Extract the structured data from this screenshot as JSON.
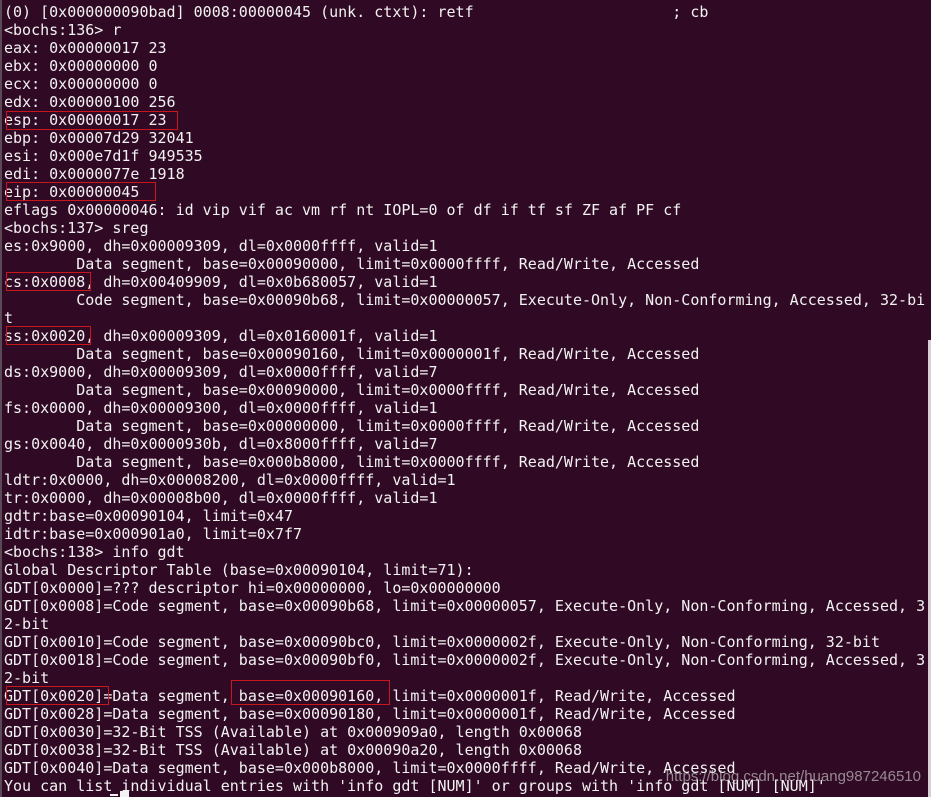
{
  "terminal": {
    "background": "#300a24",
    "highlight_color": "#c8161d",
    "lines": [
      "(0) [0x000000090bad] 0008:00000045 (unk. ctxt): retf                      ; cb",
      "<bochs:136> r",
      "eax: 0x00000017 23",
      "ebx: 0x00000000 0",
      "ecx: 0x00000000 0",
      "edx: 0x00000100 256",
      "esp: 0x00000017 23",
      "ebp: 0x00007d29 32041",
      "esi: 0x000e7d1f 949535",
      "edi: 0x0000077e 1918",
      "eip: 0x00000045",
      "eflags 0x00000046: id vip vif ac vm rf nt IOPL=0 of df if tf sf ZF af PF cf",
      "<bochs:137> sreg",
      "es:0x9000, dh=0x00009309, dl=0x0000ffff, valid=1",
      "        Data segment, base=0x00090000, limit=0x0000ffff, Read/Write, Accessed",
      "cs:0x0008, dh=0x00409909, dl=0x0b680057, valid=1",
      "        Code segment, base=0x00090b68, limit=0x00000057, Execute-Only, Non-Conforming, Accessed, 32-bi",
      "t",
      "ss:0x0020, dh=0x00009309, dl=0x0160001f, valid=1",
      "        Data segment, base=0x00090160, limit=0x0000001f, Read/Write, Accessed",
      "ds:0x9000, dh=0x00009309, dl=0x0000ffff, valid=7",
      "        Data segment, base=0x00090000, limit=0x0000ffff, Read/Write, Accessed",
      "fs:0x0000, dh=0x00009300, dl=0x0000ffff, valid=1",
      "        Data segment, base=0x00000000, limit=0x0000ffff, Read/Write, Accessed",
      "gs:0x0040, dh=0x0000930b, dl=0x8000ffff, valid=7",
      "        Data segment, base=0x000b8000, limit=0x0000ffff, Read/Write, Accessed",
      "ldtr:0x0000, dh=0x00008200, dl=0x0000ffff, valid=1",
      "tr:0x0000, dh=0x00008b00, dl=0x0000ffff, valid=1",
      "gdtr:base=0x00090104, limit=0x47",
      "idtr:base=0x000901a0, limit=0x7f7",
      "<bochs:138> info gdt",
      "Global Descriptor Table (base=0x00090104, limit=71):",
      "GDT[0x0000]=??? descriptor hi=0x00000000, lo=0x00000000",
      "GDT[0x0008]=Code segment, base=0x00090b68, limit=0x00000057, Execute-Only, Non-Conforming, Accessed, 3",
      "2-bit",
      "GDT[0x0010]=Code segment, base=0x00090bc0, limit=0x0000002f, Execute-Only, Non-Conforming, 32-bit",
      "GDT[0x0018]=Code segment, base=0x00090bf0, limit=0x0000002f, Execute-Only, Non-Conforming, Accessed, 3",
      "2-bit",
      "GDT[0x0020]=Data segment, base=0x00090160, limit=0x0000001f, Read/Write, Accessed",
      "GDT[0x0028]=Data segment, base=0x00090180, limit=0x0000001f, Read/Write, Accessed",
      "GDT[0x0030]=32-Bit TSS (Available) at 0x000909a0, length 0x00068",
      "GDT[0x0038]=32-Bit TSS (Available) at 0x00090a20, length 0x00068",
      "GDT[0x0040]=Data segment, base=0x000b8000, limit=0x0000ffff, Read/Write, Accessed",
      "You can list individual entries with 'info gdt [NUM]' or groups with 'info gdt [NUM] [NUM]'"
    ]
  },
  "watermark": "https://blog.csdn.net/huang987246510"
}
